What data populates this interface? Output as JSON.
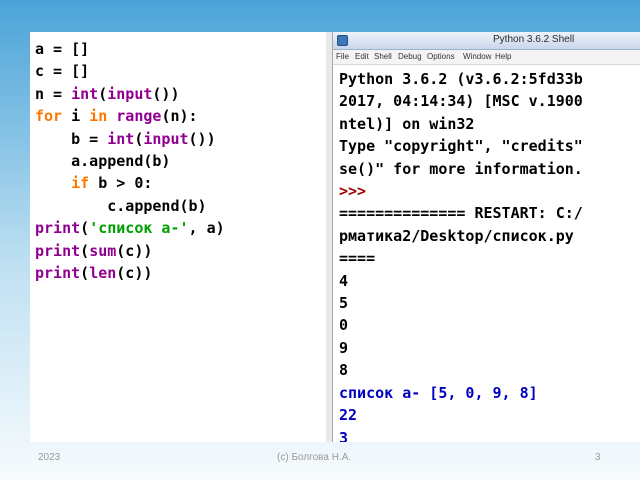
{
  "code_lines": [
    [
      {
        "t": "a = []",
        "c": ""
      }
    ],
    [
      {
        "t": "c = []",
        "c": ""
      }
    ],
    [
      {
        "t": "n = ",
        "c": ""
      },
      {
        "t": "int",
        "c": "bi"
      },
      {
        "t": "(",
        "c": ""
      },
      {
        "t": "input",
        "c": "bi"
      },
      {
        "t": "())",
        "c": ""
      }
    ],
    [
      {
        "t": "for",
        "c": "kw"
      },
      {
        "t": " i ",
        "c": ""
      },
      {
        "t": "in",
        "c": "kw"
      },
      {
        "t": " ",
        "c": ""
      },
      {
        "t": "range",
        "c": "bi"
      },
      {
        "t": "(n):",
        "c": ""
      }
    ],
    [
      {
        "t": "    b = ",
        "c": ""
      },
      {
        "t": "int",
        "c": "bi"
      },
      {
        "t": "(",
        "c": ""
      },
      {
        "t": "input",
        "c": "bi"
      },
      {
        "t": "())",
        "c": ""
      }
    ],
    [
      {
        "t": "    a.append(b)",
        "c": ""
      }
    ],
    [
      {
        "t": "    ",
        "c": ""
      },
      {
        "t": "if",
        "c": "kw"
      },
      {
        "t": " b > 0:",
        "c": ""
      }
    ],
    [
      {
        "t": "        c.append(b)",
        "c": ""
      }
    ],
    [
      {
        "t": "print",
        "c": "bi"
      },
      {
        "t": "(",
        "c": ""
      },
      {
        "t": "'список а-'",
        "c": "str"
      },
      {
        "t": ", a)",
        "c": ""
      }
    ],
    [
      {
        "t": "print",
        "c": "bi"
      },
      {
        "t": "(",
        "c": ""
      },
      {
        "t": "sum",
        "c": "bi"
      },
      {
        "t": "(c))",
        "c": ""
      }
    ],
    [
      {
        "t": "print",
        "c": "bi"
      },
      {
        "t": "(",
        "c": ""
      },
      {
        "t": "len",
        "c": "bi"
      },
      {
        "t": "(c))",
        "c": ""
      }
    ]
  ],
  "shell": {
    "window_title": "Python 3.6.2 Shell",
    "menu": [
      "File",
      "Edit",
      "Shell",
      "Debug",
      "Options",
      "Window",
      "Help"
    ],
    "lines": [
      {
        "t": "Python 3.6.2 (v3.6.2:5fd33b",
        "c": ""
      },
      {
        "t": "2017, 04:14:34) [MSC v.1900",
        "c": ""
      },
      {
        "t": "ntel)] on win32",
        "c": ""
      },
      {
        "t": "Type \"copyright\", \"credits\"",
        "c": ""
      },
      {
        "t": "se()\" for more information.",
        "c": ""
      },
      {
        "t": ">>>",
        "c": "prompt"
      },
      {
        "t": "============== RESTART: C:/",
        "c": ""
      },
      {
        "t": "рматика2/Desktop/список.py",
        "c": ""
      },
      {
        "t": "====",
        "c": ""
      },
      {
        "t": "4",
        "c": ""
      },
      {
        "t": "5",
        "c": ""
      },
      {
        "t": "0",
        "c": ""
      },
      {
        "t": "9",
        "c": ""
      },
      {
        "t": "8",
        "c": ""
      },
      {
        "t": "список а- [5, 0, 9, 8]",
        "c": "out-blue"
      },
      {
        "t": "22",
        "c": "out-blue"
      },
      {
        "t": "3",
        "c": "out-blue"
      }
    ]
  },
  "footer": {
    "year": "2023",
    "author": "(c) Болгова Н.А.",
    "page": "3"
  }
}
